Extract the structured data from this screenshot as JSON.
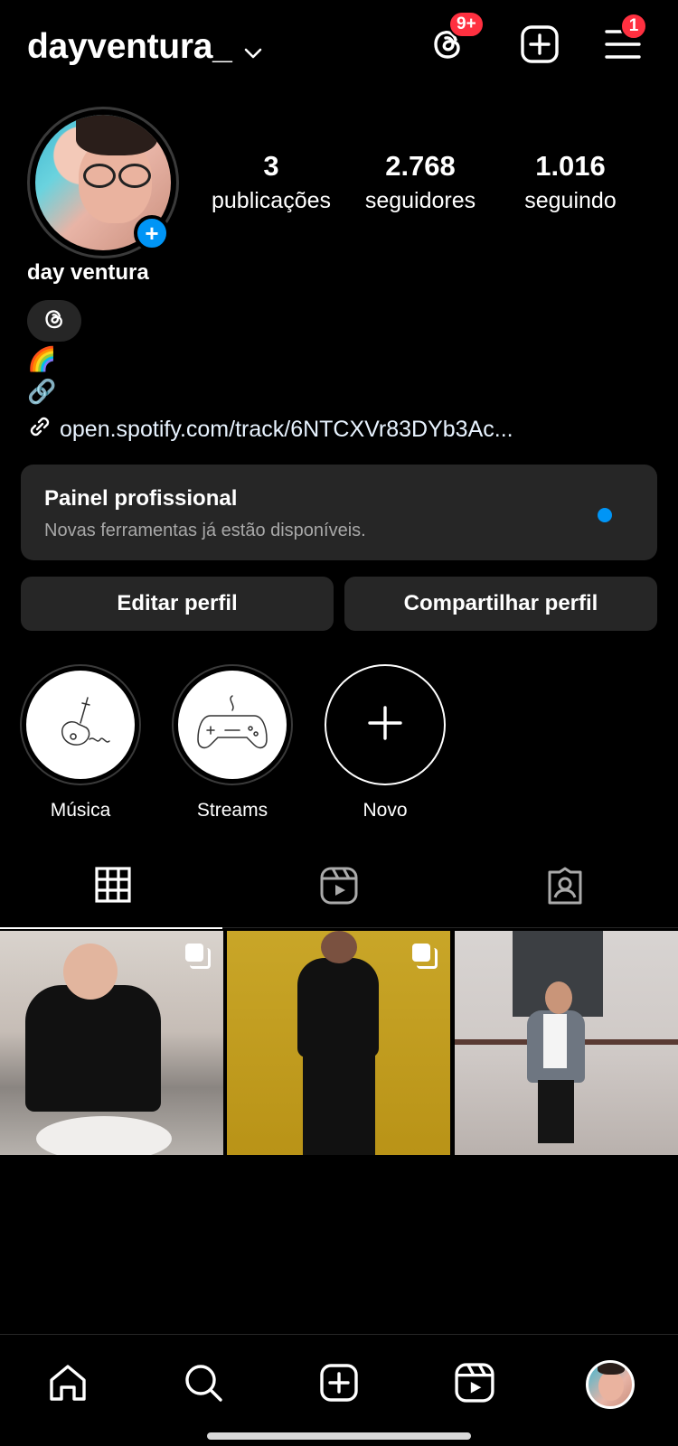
{
  "header": {
    "username": "dayventura_",
    "threads_badge": "9+",
    "menu_badge": "1"
  },
  "profile": {
    "full_name": "day ventura",
    "stats": [
      {
        "value": "3",
        "label": "publicações"
      },
      {
        "value": "2.768",
        "label": "seguidores"
      },
      {
        "value": "1.016",
        "label": "seguindo"
      }
    ],
    "bio_lines": [
      "🌈",
      "🔗"
    ],
    "link_text": "open.spotify.com/track/6NTCXVr83DYb3Ac..."
  },
  "panel": {
    "title": "Painel profissional",
    "subtitle": "Novas ferramentas já estão disponíveis."
  },
  "buttons": {
    "edit": "Editar perfil",
    "share": "Compartilhar perfil"
  },
  "highlights": [
    {
      "label": "Música"
    },
    {
      "label": "Streams"
    },
    {
      "label": "Novo"
    }
  ],
  "colors": {
    "accent": "#0095f6",
    "badge": "#ff3040",
    "surface": "#262626",
    "background": "#000000"
  },
  "icons": {
    "header": [
      "chevron-down-icon",
      "threads-icon",
      "create-icon",
      "menu-icon"
    ],
    "tabs": [
      "grid-icon",
      "reels-icon",
      "tagged-icon"
    ],
    "nav": [
      "home-icon",
      "search-icon",
      "create-icon",
      "reels-icon",
      "profile-avatar"
    ]
  }
}
